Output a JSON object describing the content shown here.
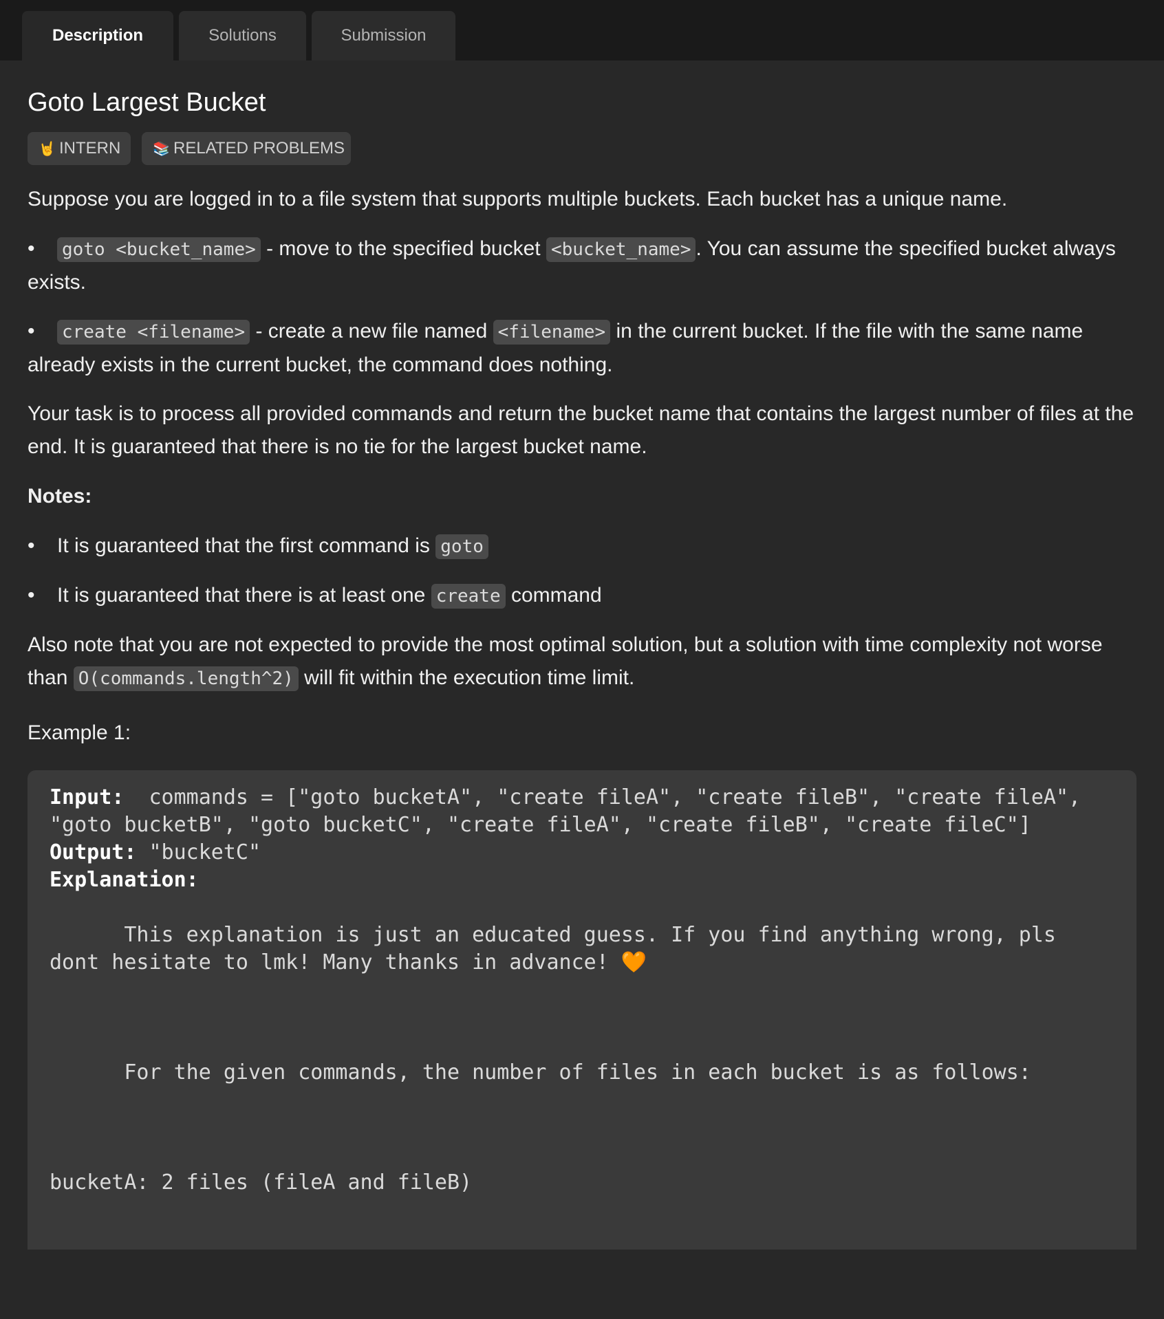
{
  "tabs": [
    {
      "label": "Description",
      "active": true
    },
    {
      "label": "Solutions",
      "active": false
    },
    {
      "label": "Submission",
      "active": false
    }
  ],
  "problem": {
    "title": "Goto Largest Bucket",
    "tags": [
      {
        "icon": "rock-hand-icon",
        "glyph": "🤘",
        "label": "INTERN"
      },
      {
        "icon": "books-icon",
        "glyph": "📚",
        "label": "RELATED PROBLEMS"
      }
    ],
    "intro": "Suppose you are logged in to a file system that supports multiple buckets. Each bucket has a unique name.",
    "cmd1": {
      "code": "goto <bucket_name>",
      "text1": " - move to the specified bucket ",
      "code2": "<bucket_name>",
      "text2": ". You can assume the specified bucket always exists."
    },
    "cmd2": {
      "code": "create <filename>",
      "text1": " - create a new file named ",
      "code2": "<filename>",
      "text2": " in the current bucket. If the file with the same name already exists in the current bucket, the command does nothing."
    },
    "task": "Your task is to process all provided commands and return the bucket name that contains the largest number of files at the end. It is guaranteed that there is no tie for the largest bucket name.",
    "notes_heading": "Notes:",
    "note1": {
      "text": "It is guaranteed that the first command is ",
      "code": "goto"
    },
    "note2": {
      "text1": "It is guaranteed that there is at least one ",
      "code": "create",
      "text2": " command"
    },
    "also": {
      "text1": "Also note that you are not expected to provide the most optimal solution, but a solution with time complexity not worse than ",
      "code": "O(commands.length^2)",
      "text2": " will fit within the execution time limit."
    },
    "example_heading": "Example 1:",
    "example": {
      "input_label": "Input:",
      "input_value": "  commands = [\"goto bucketA\", \"create fileA\", \"create fileB\", \"create fileA\", \"goto bucketB\", \"goto bucketC\", \"create fileA\", \"create fileB\", \"create fileC\"]",
      "output_label": "Output:",
      "output_value": " \"bucketC\"",
      "explanation_label": "Explanation:",
      "explanation_p1": "      This explanation is just an educated guess. If you find anything wrong, pls dont hesitate to lmk! Many thanks in advance! 🧡",
      "explanation_p2": "      For the given commands, the number of files in each bucket is as follows:",
      "explanation_p3": "bucketA: 2 files (fileA and fileB)"
    }
  }
}
